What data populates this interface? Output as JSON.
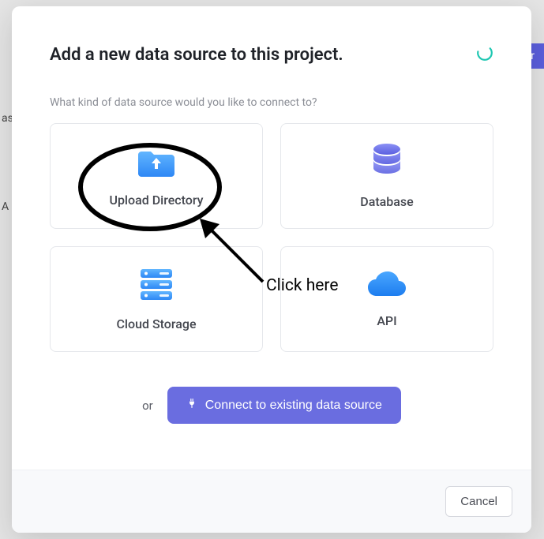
{
  "background": {
    "button_fragment": "Cor",
    "text1": "as",
    "text2": "A"
  },
  "modal": {
    "title": "Add a new data source to this project.",
    "subtitle": "What kind of data source would you like to connect to?",
    "cards": {
      "upload_directory": "Upload Directory",
      "database": "Database",
      "cloud_storage": "Cloud Storage",
      "api": "API"
    },
    "or_label": "or",
    "connect_button": "Connect to existing data source",
    "cancel_button": "Cancel"
  },
  "annotation": {
    "label": "Click here"
  }
}
